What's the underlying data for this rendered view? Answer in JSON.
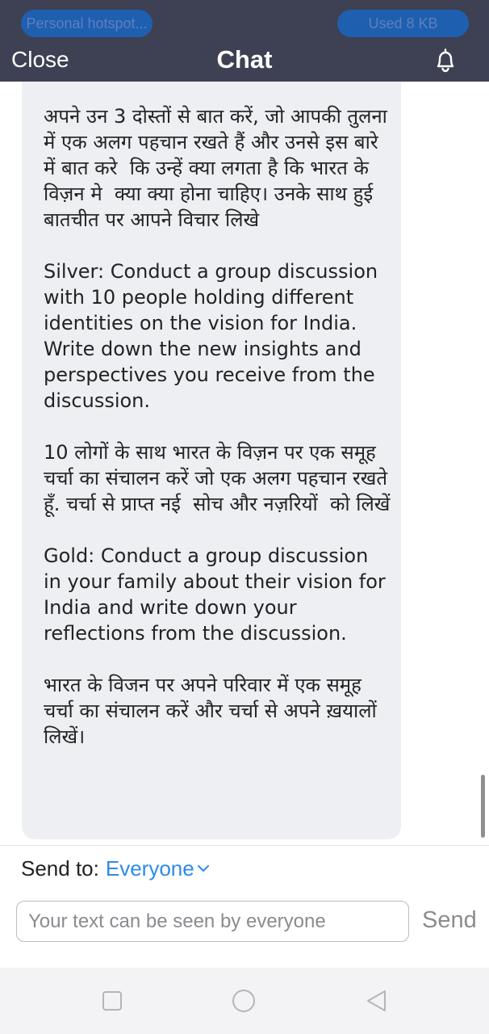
{
  "status_bar": {
    "left_pill": "Personal hotspot...",
    "right_pill": "Used  8 KB"
  },
  "header": {
    "close_label": "Close",
    "title": "Chat",
    "bell_icon": "bell-icon"
  },
  "message": {
    "text": "अपने उन 3 दोस्तों से बात करें, जो आपकी तुलना में एक अलग पहचान रखते हैं और उनसे इस बारे में बात करे  कि उन्हें क्या लगता है कि भारत के विज़न मे  क्या क्या होना चाहिए। उनके साथ हुई बातचीत पर आपने विचार लिखे\n\nSilver: Conduct a group discussion with 10 people holding different identities on the vision for India. Write down the new insights and perspectives you receive from the discussion.\n\n10 लोगों के साथ भारत के विज़न पर एक समूह चर्चा का संचालन करें जो एक अलग पहचान रखते हूँ. चर्चा से प्राप्त नई  सोच और नज़रियों  को लिखें\n\nGold: Conduct a group discussion in your family about their vision for India and write down your reflections from the discussion.\n\nभारत के विजन पर अपने परिवार में एक समूह चर्चा का संचालन करें और चर्चा से अपने ख़यालों लिखें।"
  },
  "send_to": {
    "label": "Send to:",
    "value": "Everyone",
    "chevron_icon": "chevron-down-icon"
  },
  "composer": {
    "placeholder": "Your text can be seen by everyone",
    "send_label": "Send"
  },
  "colors": {
    "header_bg": "#3d4153",
    "accent": "#2d8be8",
    "bubble_bg": "#eeeff3"
  },
  "navbar": {
    "icons": [
      "square-icon",
      "circle-icon",
      "back-triangle-icon"
    ]
  }
}
